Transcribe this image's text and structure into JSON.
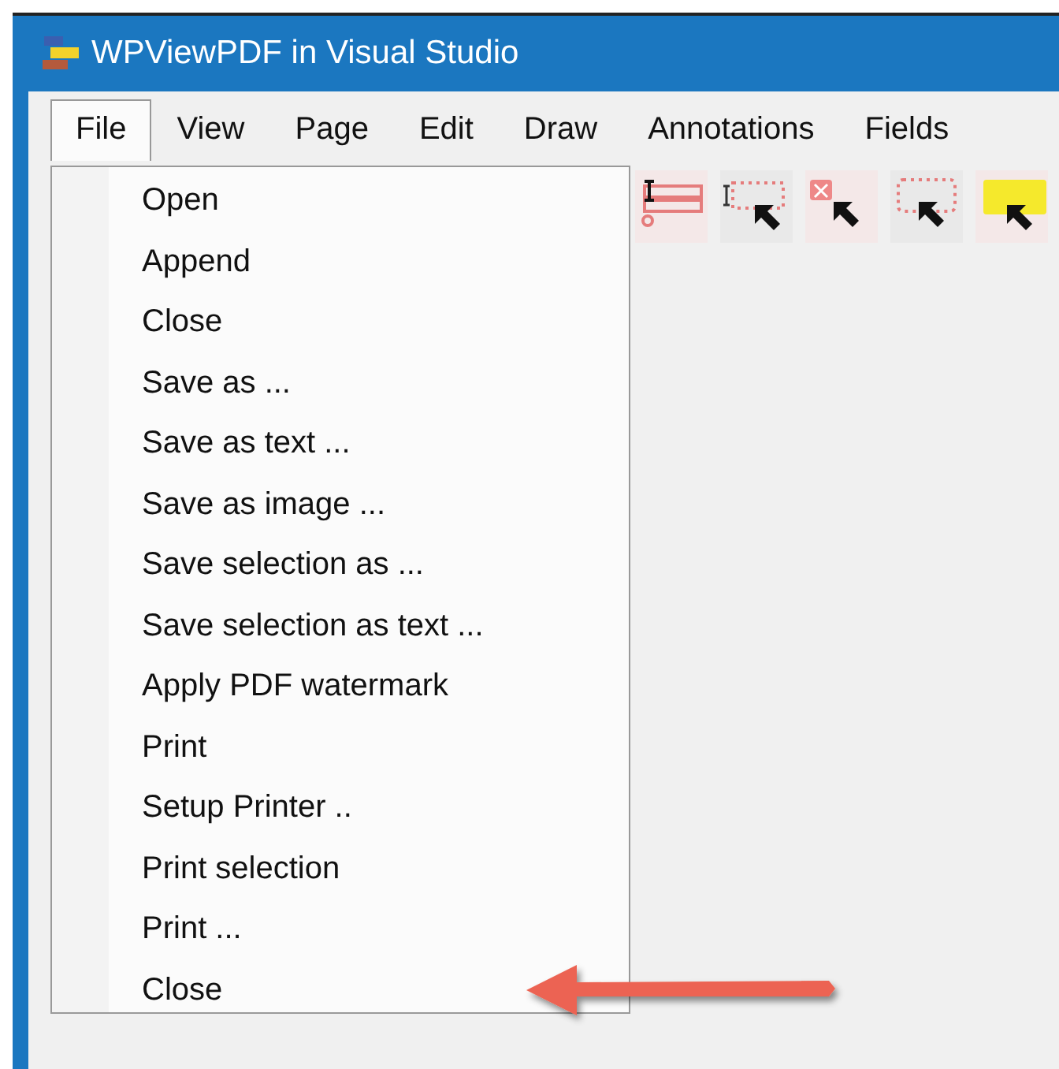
{
  "window": {
    "title": "WPViewPDF in Visual Studio"
  },
  "menu_bar": [
    {
      "label": "File",
      "selected": true
    },
    {
      "label": "View",
      "selected": false
    },
    {
      "label": "Page",
      "selected": false
    },
    {
      "label": "Edit",
      "selected": false
    },
    {
      "label": "Draw",
      "selected": false
    },
    {
      "label": "Annotations",
      "selected": false
    },
    {
      "label": "Fields",
      "selected": false
    }
  ],
  "file_menu": [
    "Open",
    "Append",
    "Close",
    "Save as ...",
    "Save as text ...",
    "Save as image ...",
    "Save selection as ...",
    "Save selection as text ...",
    "Apply PDF watermark",
    "Print",
    "Setup Printer ..",
    "Print selection",
    "Print ...",
    "Close"
  ]
}
